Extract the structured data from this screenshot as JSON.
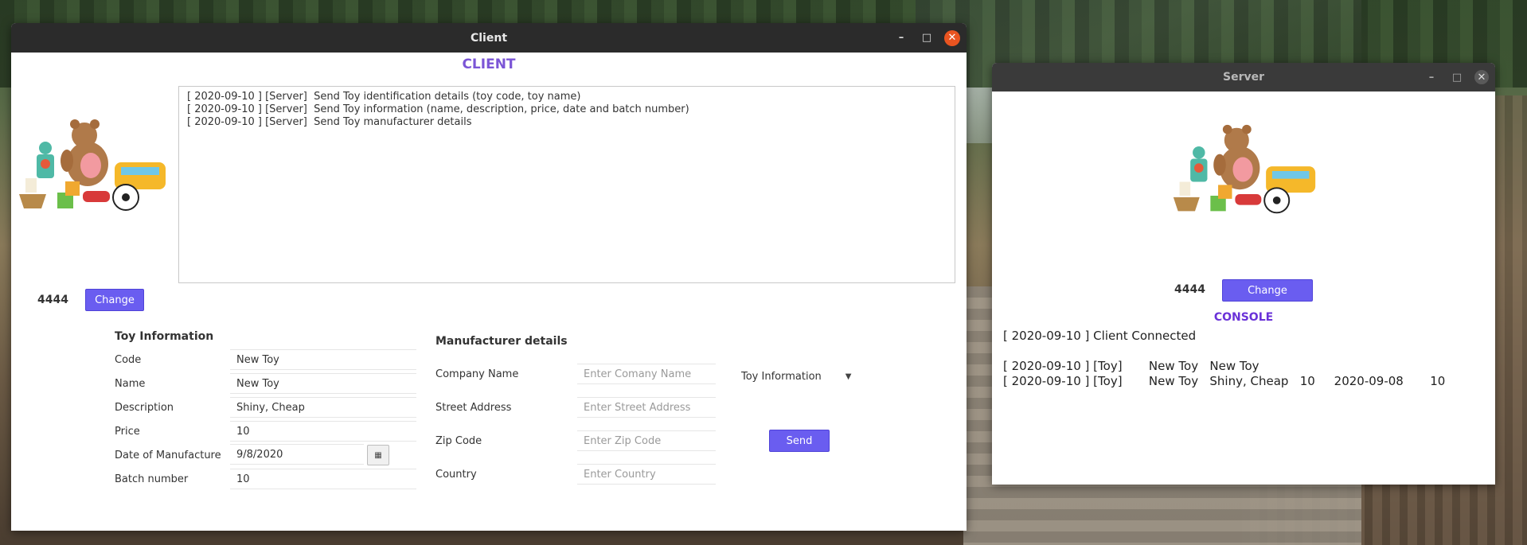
{
  "client_window": {
    "title": "Client",
    "heading": "CLIENT",
    "log_lines": [
      "[ 2020-09-10 ] [Server]  Send Toy identification details (toy code, toy name)",
      "[ 2020-09-10 ] [Server]  Send Toy information (name, description, price, date and batch number)",
      "[ 2020-09-10 ] [Server]  Send Toy manufacturer details"
    ],
    "port": "4444",
    "change_label": "Change",
    "toy_info": {
      "title": "Toy Information",
      "fields": [
        {
          "label": "Code",
          "value": "New Toy"
        },
        {
          "label": "Name",
          "value": "New Toy"
        },
        {
          "label": "Description",
          "value": "Shiny, Cheap"
        },
        {
          "label": "Price",
          "value": "10"
        },
        {
          "label": "Date of Manufacture",
          "value": "9/8/2020"
        },
        {
          "label": "Batch number",
          "value": "10"
        }
      ]
    },
    "manufacturer": {
      "title": "Manufacturer details",
      "fields": [
        {
          "label": "Company Name",
          "placeholder": "Enter Comany Name"
        },
        {
          "label": "Street Address",
          "placeholder": "Enter Street Address"
        },
        {
          "label": "Zip Code",
          "placeholder": "Enter Zip Code"
        },
        {
          "label": "Country",
          "placeholder": "Enter Country"
        }
      ]
    },
    "dropdown_value": "Toy Information",
    "send_label": "Send"
  },
  "server_window": {
    "title": "Server",
    "port": "4444",
    "change_label": "Change",
    "console_title": "CONSOLE",
    "console_lines": [
      "[ 2020-09-10 ] Client Connected",
      "[ 2020-09-10 ] [Toy]       New Toy   New Toy",
      "[ 2020-09-10 ] [Toy]       New Toy   Shiny, Cheap   10     2020-09-08       10"
    ]
  },
  "colors": {
    "accent": "#6a5df0",
    "client_heading": "#7b55d6",
    "console_heading": "#6a32d8",
    "close_button": "#e95420"
  }
}
